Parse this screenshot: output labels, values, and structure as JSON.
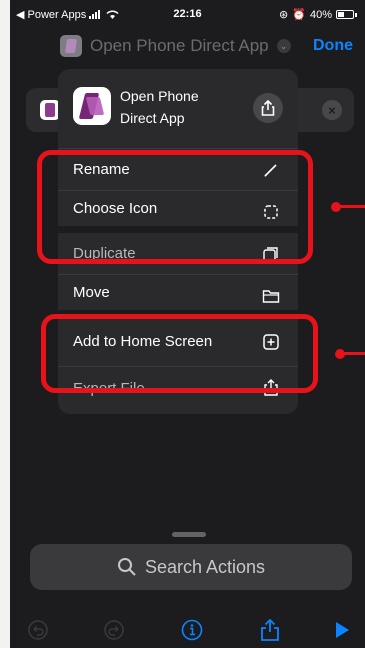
{
  "status_bar": {
    "carrier": "◀ Power Apps",
    "time": "22:16",
    "battery": "40%"
  },
  "nav": {
    "title": "Open Phone Direct App",
    "done_label": "Done"
  },
  "menu": {
    "app_name": "Open Phone Direct App",
    "items": [
      {
        "label": "Rename",
        "icon": "pencil-icon"
      },
      {
        "label": "Choose Icon",
        "icon": "dashed-square-icon"
      },
      {
        "label": "Duplicate",
        "icon": "duplicate-icon"
      },
      {
        "label": "Move",
        "icon": "folder-icon"
      },
      {
        "label": "Add to Home Screen",
        "icon": "plus-square-icon"
      },
      {
        "label": "Export File",
        "icon": "export-icon"
      }
    ]
  },
  "search": {
    "placeholder": "Search Actions"
  },
  "colors": {
    "accent": "#0a84ff",
    "highlight": "#e8121a",
    "background": "#1c1c1e",
    "menu": "#2a2a2c"
  }
}
